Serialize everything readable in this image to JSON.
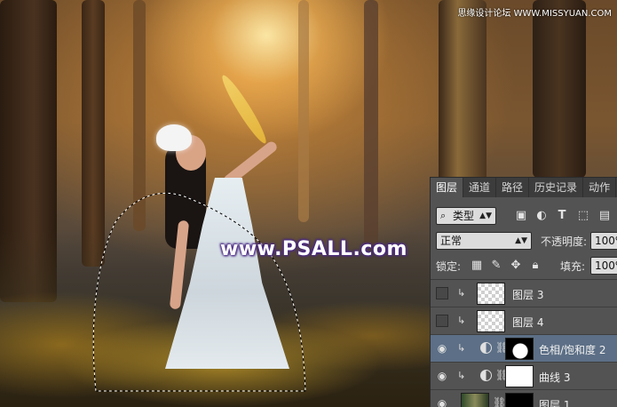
{
  "watermark": "www.PSALL.com",
  "site_mark": "思缘设计论坛 WWW.MISSYUAN.COM",
  "panel": {
    "tabs": [
      "图层",
      "通道",
      "路径",
      "历史记录",
      "动作"
    ],
    "active_tab": "图层",
    "filter_label": "类型",
    "blend_mode": "正常",
    "opacity_label": "不透明度:",
    "opacity_value": "100%",
    "lock_label": "锁定:",
    "fill_label": "填充:",
    "fill_value": "100%",
    "layers": [
      {
        "name": "图层 3",
        "visible": false,
        "clipped": true,
        "thumb": "transparent"
      },
      {
        "name": "图层 4",
        "visible": false,
        "clipped": true,
        "thumb": "transparent"
      },
      {
        "name": "色相/饱和度 2",
        "visible": true,
        "clipped": true,
        "thumb": "adjustment-mask",
        "selected": true
      },
      {
        "name": "曲线 3",
        "visible": true,
        "clipped": true,
        "thumb": "adjustment-white"
      },
      {
        "name": "图层 1",
        "visible": true,
        "clipped": false,
        "thumb": "photo"
      }
    ]
  },
  "colors": {
    "panel_bg": "#535353",
    "panel_tabs_bg": "#3c3c3c",
    "selected_layer": "#5c6f86",
    "watermark_outline": "#4b2a86"
  }
}
